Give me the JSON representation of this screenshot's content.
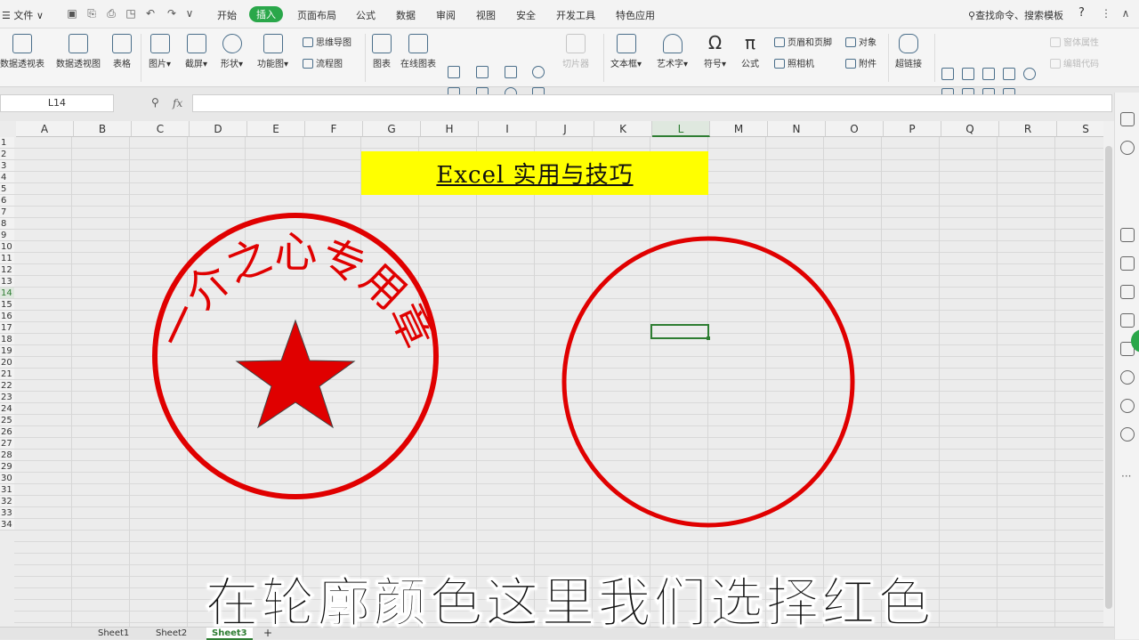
{
  "menubar": {
    "file_label": "文件",
    "tabs": [
      "开始",
      "插入",
      "页面布局",
      "公式",
      "数据",
      "审阅",
      "视图",
      "安全",
      "开发工具",
      "特色应用"
    ],
    "active_tab": "插入",
    "search_label": "查找命令、搜索模板",
    "help_label": "?"
  },
  "ribbon": {
    "pivot_table": "数据透视表",
    "pivot_chart": "数据透视图",
    "table": "表格",
    "picture": "图片",
    "screenshot": "截屏",
    "shapes": "形状",
    "function_chart": "功能图",
    "mindmap": "思维导图",
    "flowchart": "流程图",
    "chart": "图表",
    "online_chart": "在线图表",
    "slicer": "切片器",
    "textbox": "文本框",
    "wordart": "艺术字",
    "symbol": "符号",
    "equation": "公式",
    "header_footer": "页眉和页脚",
    "camera": "照相机",
    "object": "对象",
    "attachment": "附件",
    "hyperlink": "超链接",
    "form_properties": "窗体属性",
    "edit_code": "编辑代码"
  },
  "formula_bar": {
    "name_box": "L14",
    "fx_label": "fx",
    "formula": ""
  },
  "grid": {
    "columns": [
      "A",
      "B",
      "C",
      "D",
      "E",
      "F",
      "G",
      "H",
      "I",
      "J",
      "K",
      "L",
      "M",
      "N",
      "O",
      "P",
      "Q",
      "R",
      "S"
    ],
    "selected_column": "L",
    "rows": [
      "1",
      "2",
      "3",
      "4",
      "5",
      "6",
      "7",
      "8",
      "9",
      "10",
      "11",
      "12",
      "13",
      "14",
      "15",
      "16",
      "17",
      "18",
      "19",
      "20",
      "21",
      "22",
      "23",
      "24",
      "25",
      "26",
      "27",
      "28",
      "29",
      "30",
      "31",
      "32",
      "33",
      "34"
    ],
    "selected_row": "14"
  },
  "title_cell": {
    "text": "Excel 实用与技巧",
    "fill_color": "#ffff00"
  },
  "stamp": {
    "text": "一介之心专用章",
    "color": "#e00000"
  },
  "circle_shape": {
    "color": "#e00000"
  },
  "caption": "在轮廓颜色这里我们选择红色",
  "sheet_tabs": [
    "Sheet1",
    "Sheet2",
    "Sheet3"
  ],
  "active_sheet": "Sheet3",
  "add_sheet_label": "+"
}
